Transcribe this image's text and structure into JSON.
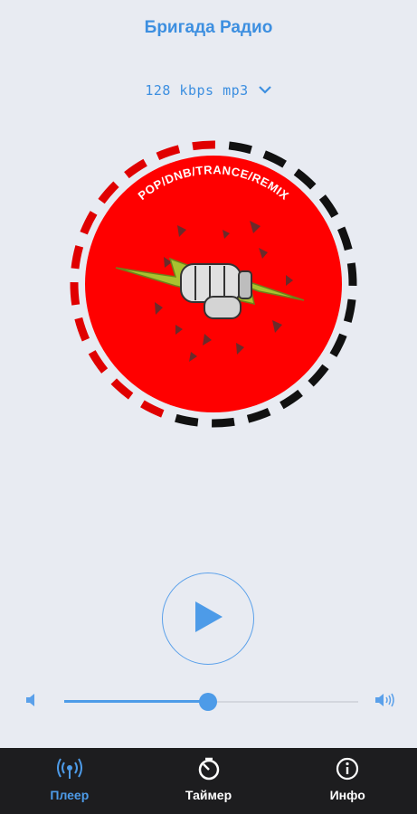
{
  "app": {
    "title": "Бригада Радио"
  },
  "stream": {
    "quality": "128 kbps mp3"
  },
  "logo": {
    "arc_text": "POP/DNB/TRANCE/REMIX",
    "background_color": "#ff0000",
    "ring_colors": [
      "#e00000",
      "#111111"
    ]
  },
  "player": {
    "state": "paused",
    "play_icon": "play-icon"
  },
  "volume": {
    "level": 0.49,
    "accent_color": "#4d9be8"
  },
  "nav": {
    "items": [
      {
        "label": "Плеер",
        "icon": "radio-waves-icon",
        "active": true
      },
      {
        "label": "Таймер",
        "icon": "timer-icon",
        "active": false
      },
      {
        "label": "Инфо",
        "icon": "info-icon",
        "active": false
      }
    ]
  }
}
